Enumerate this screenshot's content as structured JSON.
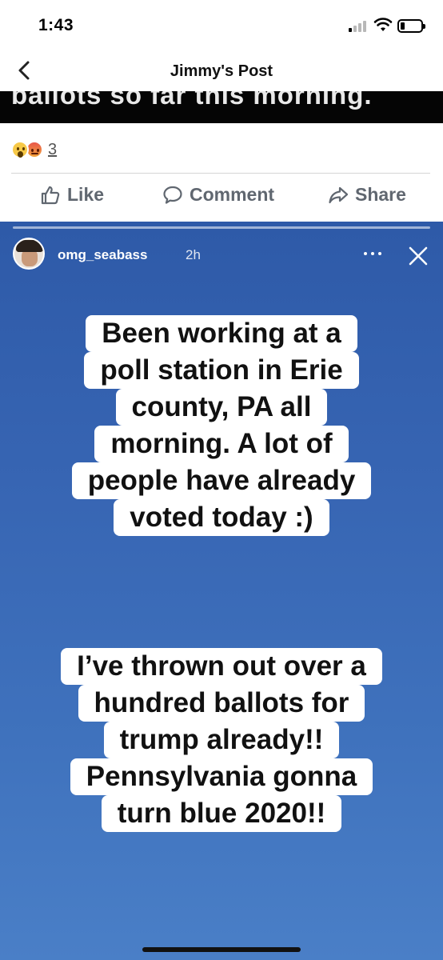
{
  "status_bar": {
    "time": "1:43",
    "icons": [
      "cellular-signal-icon",
      "wifi-icon",
      "battery-icon"
    ],
    "battery_level": 0.2
  },
  "header": {
    "back_icon": "chevron-left-icon",
    "title": "Jimmy's Post"
  },
  "cropped_image": {
    "text": "ballots so far this morning."
  },
  "reactions": {
    "icons": [
      "wow-reaction-icon",
      "angry-reaction-icon"
    ],
    "count": "3"
  },
  "actions": [
    {
      "icon": "like-icon",
      "label": "Like"
    },
    {
      "icon": "comment-icon",
      "label": "Comment"
    },
    {
      "icon": "share-icon",
      "label": "Share"
    }
  ],
  "story": {
    "username": "omg_seabass",
    "time": "2h",
    "more_icon": "more-dots-icon",
    "close_icon": "close-icon",
    "background_color": "#3765b3",
    "text_block_1": [
      "Been working at a",
      "poll station in Erie",
      "county, PA all",
      "morning. A lot of",
      "people have already",
      "voted today :)"
    ],
    "text_block_2": [
      "I’ve thrown out over a",
      "hundred ballots for",
      "trump already!!",
      "Pennsylvania gonna",
      "turn blue 2020!!"
    ]
  }
}
